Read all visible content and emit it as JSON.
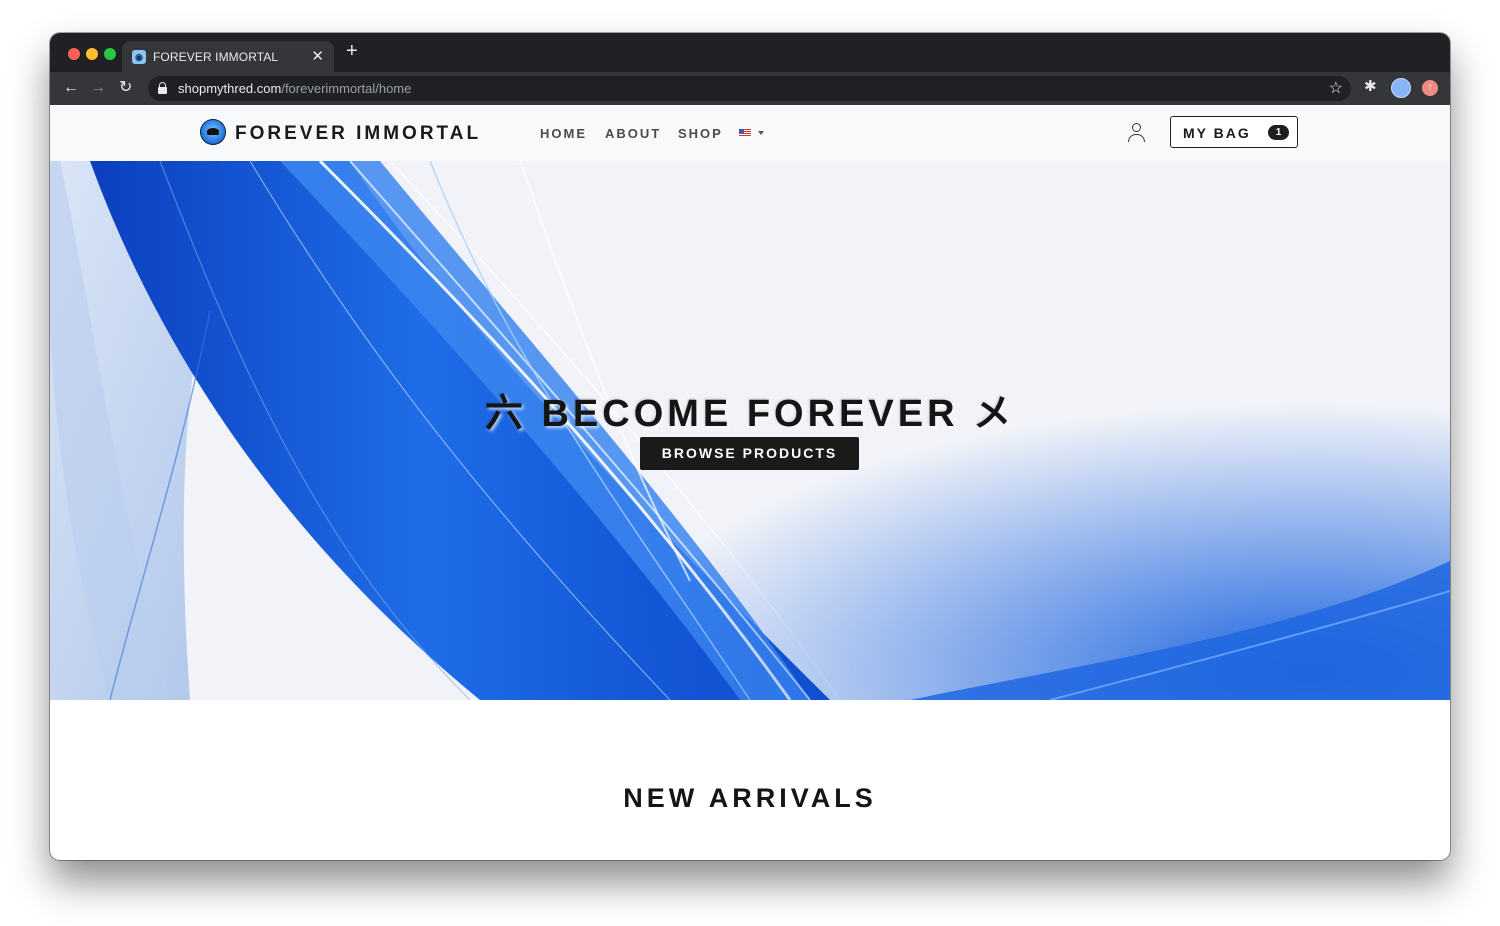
{
  "browser": {
    "tab_title": "FOREVER IMMORTAL",
    "tab_close": "✕",
    "new_tab": "+",
    "back": "←",
    "forward": "→",
    "reload": "↻",
    "url_domain": "shopmythred.com",
    "url_path": "/foreverimmortal/home",
    "bookmark": "☆",
    "extensions": "✱"
  },
  "nav": {
    "brand": "FOREVER IMMORTAL",
    "links": [
      "HOME",
      "ABOUT",
      "SHOP"
    ],
    "bag_label": "MY BAG",
    "bag_count": "1"
  },
  "hero": {
    "title": "六 BECOME FOREVER メ",
    "button": "BROWSE PRODUCTS"
  },
  "section": {
    "title": "NEW ARRIVALS"
  },
  "colors": {
    "chrome_dark": "#202124",
    "chrome_tab": "#35363a",
    "hero_blue": "#1e5fd6",
    "button_dark": "#1a1a1a"
  }
}
